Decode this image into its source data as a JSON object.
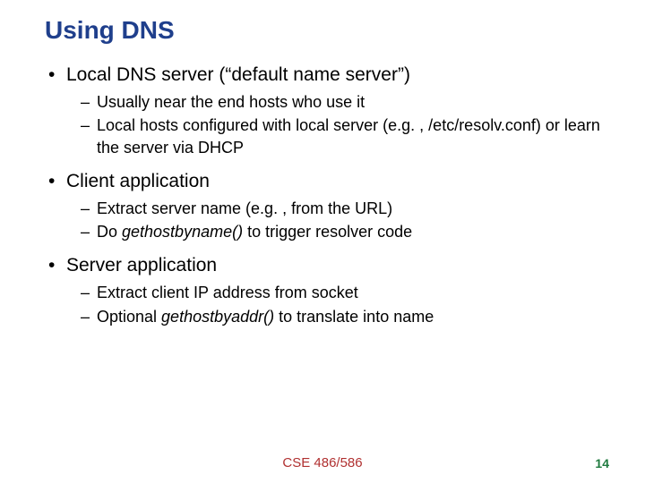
{
  "title": "Using DNS",
  "bullets": [
    {
      "text": "Local DNS server (“default name server”)",
      "sub": [
        "Usually near the end hosts who use it",
        "Local hosts configured with local server (e.g. , /etc/resolv.conf) or learn the server via DHCP"
      ]
    },
    {
      "text": "Client application",
      "sub": [
        "Extract server name (e.g. , from the URL)",
        "Do <em>gethostbyname()</em> to trigger resolver code"
      ]
    },
    {
      "text": "Server application",
      "sub": [
        "Extract client IP address from socket",
        "Optional <em>gethostbyaddr()</em> to translate into name"
      ]
    }
  ],
  "footer": {
    "center": "CSE 486/586",
    "page": "14"
  }
}
